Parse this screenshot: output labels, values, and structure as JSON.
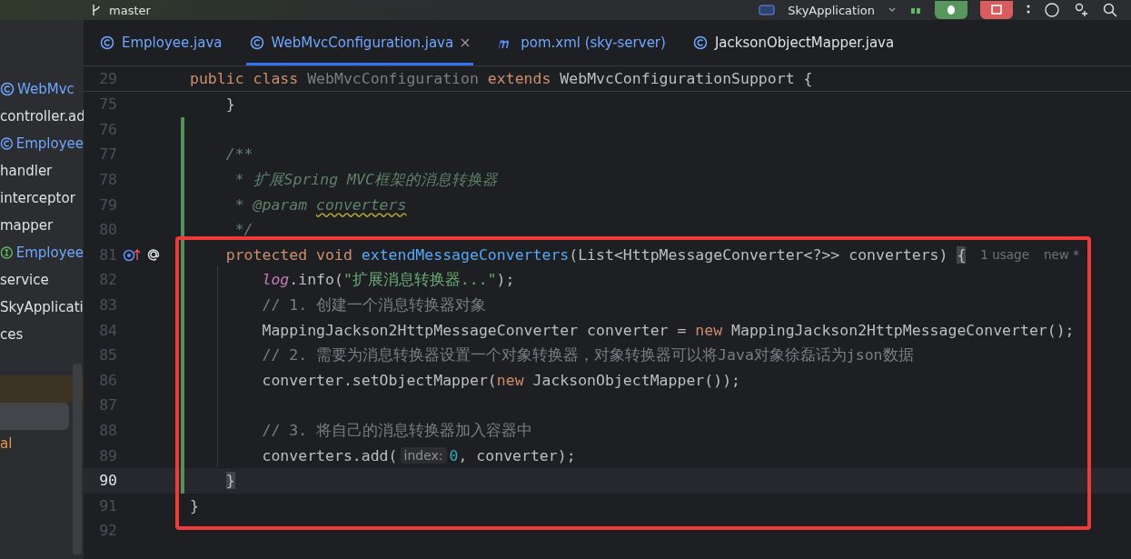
{
  "toolbar": {
    "branch": "master",
    "run_config": "SkyApplication"
  },
  "sidebar": {
    "items": [
      {
        "kind": "class",
        "text": "WebMvc",
        "selected": false
      },
      {
        "kind": "package",
        "text": "controller.ad",
        "selected": false
      },
      {
        "kind": "class",
        "text": "Employee",
        "selected": false
      },
      {
        "kind": "package",
        "text": "handler",
        "selected": false
      },
      {
        "kind": "package",
        "text": "interceptor",
        "selected": false
      },
      {
        "kind": "package",
        "text": "mapper",
        "selected": false
      },
      {
        "kind": "interface",
        "text": "Employee",
        "selected": false
      },
      {
        "kind": "package",
        "text": "service",
        "selected": false
      },
      {
        "kind": "package",
        "text": "SkyApplicati",
        "selected": false
      },
      {
        "kind": "package",
        "text": "ces",
        "selected": false
      },
      {
        "kind": "marked",
        "selected": false
      },
      {
        "kind": "blank",
        "selected": true
      },
      {
        "kind": "ignored",
        "text": "al",
        "selected": false
      }
    ]
  },
  "tabs": [
    {
      "kind": "class",
      "label": "Employee.java",
      "modified": true,
      "selected": false
    },
    {
      "kind": "class",
      "label": "WebMvcConfiguration.java",
      "modified": true,
      "selected": true
    },
    {
      "kind": "maven",
      "label": "pom.xml (sky-server)",
      "modified": true,
      "selected": false
    },
    {
      "kind": "class",
      "label": "JacksonObjectMapper.java",
      "modified": false,
      "selected": false
    }
  ],
  "sticky_line": {
    "number": "29",
    "tokens": [
      {
        "kind": "keyword",
        "text": "public "
      },
      {
        "kind": "keyword",
        "text": "class "
      },
      {
        "kind": "dim",
        "text": "WebMvcConfiguration "
      },
      {
        "kind": "keyword",
        "text": "extends "
      },
      {
        "kind": "plain",
        "text": "WebMvcConfigurationSupport {"
      }
    ]
  },
  "lines": [
    {
      "number": "75",
      "current": false,
      "tokens": [
        {
          "kind": "plain",
          "text": "    }"
        }
      ]
    },
    {
      "number": "76",
      "current": false
    },
    {
      "number": "77",
      "current": false,
      "tokens": [
        {
          "kind": "doc",
          "text": "    /**"
        }
      ]
    },
    {
      "number": "78",
      "current": false,
      "tokens": [
        {
          "kind": "doc",
          "text": "     * 扩展Spring MVC框架的消息转换器"
        }
      ]
    },
    {
      "number": "79",
      "current": false,
      "tokens": [
        {
          "kind": "doc",
          "text": "     * @param "
        },
        {
          "kind": "doc-warn",
          "text": "converters"
        }
      ]
    },
    {
      "number": "80",
      "current": false,
      "tokens": [
        {
          "kind": "doc",
          "text": "     */"
        }
      ]
    },
    {
      "number": "81",
      "current": false,
      "gutter": true,
      "tokens": [
        {
          "kind": "keyword",
          "text": "    protected "
        },
        {
          "kind": "keyword",
          "text": "void "
        },
        {
          "kind": "func",
          "text": "extendMessageConverters"
        },
        {
          "kind": "plain",
          "text": "(List<HttpMessageConverter<?>> converters) "
        },
        {
          "kind": "brace",
          "text": "{"
        },
        {
          "kind": "inlay",
          "text": "1 usage"
        },
        {
          "kind": "inlay",
          "text": "new *"
        }
      ]
    },
    {
      "number": "82",
      "current": false,
      "tokens": [
        {
          "kind": "field",
          "text": "        log"
        },
        {
          "kind": "plain",
          "text": ".info("
        },
        {
          "kind": "string",
          "text": "\"扩展消息转换器...\""
        },
        {
          "kind": "plain",
          "text": ");"
        }
      ]
    },
    {
      "number": "83",
      "current": false,
      "tokens": [
        {
          "kind": "comment",
          "text": "        // 1. 创建一个消息转换器对象"
        }
      ]
    },
    {
      "number": "84",
      "current": false,
      "tokens": [
        {
          "kind": "plain",
          "text": "        MappingJackson2HttpMessageConverter converter = "
        },
        {
          "kind": "keyword",
          "text": "new "
        },
        {
          "kind": "plain",
          "text": "MappingJackson2HttpMessageConverter();"
        }
      ]
    },
    {
      "number": "85",
      "current": false,
      "tokens": [
        {
          "kind": "comment",
          "text": "        // 2. 需要为消息转换器设置一个对象转换器，对象转换器可以将Java对象徐磊话为json数据"
        }
      ]
    },
    {
      "number": "86",
      "current": false,
      "tokens": [
        {
          "kind": "plain",
          "text": "        converter.setObjectMapper("
        },
        {
          "kind": "keyword",
          "text": "new "
        },
        {
          "kind": "plain",
          "text": "JacksonObjectMapper());"
        }
      ]
    },
    {
      "number": "87",
      "current": false
    },
    {
      "number": "88",
      "current": false,
      "tokens": [
        {
          "kind": "comment",
          "text": "        // 3. 将自己的消息转换器加入容器中"
        }
      ]
    },
    {
      "number": "89",
      "current": false,
      "tokens": [
        {
          "kind": "plain",
          "text": "        converters.add("
        },
        {
          "kind": "param-hint",
          "text": "index:"
        },
        {
          "kind": "number",
          "text": "0"
        },
        {
          "kind": "plain",
          "text": ", converter);"
        }
      ]
    },
    {
      "number": "90",
      "current": true,
      "tokens": [
        {
          "kind": "brace",
          "text": "    }"
        }
      ]
    },
    {
      "number": "91",
      "current": false,
      "tokens": [
        {
          "kind": "plain",
          "text": "}"
        }
      ]
    },
    {
      "number": "92",
      "current": false
    }
  ]
}
